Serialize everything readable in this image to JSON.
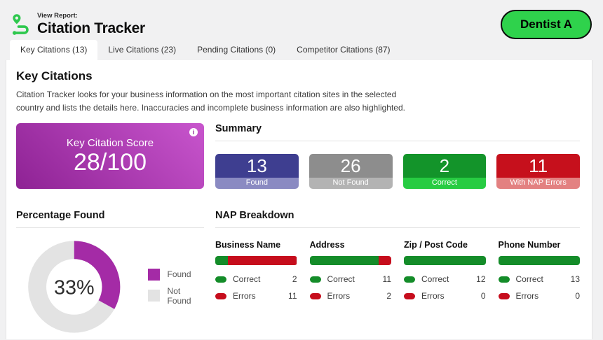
{
  "header": {
    "view_report_label": "View Report:",
    "title": "Citation Tracker",
    "business_button": "Dentist A",
    "brand_green": "#2fd24c"
  },
  "tabs": [
    {
      "label": "Key Citations (13)",
      "active": true
    },
    {
      "label": "Live Citations (23)",
      "active": false
    },
    {
      "label": "Pending Citations (0)",
      "active": false
    },
    {
      "label": "Competitor Citations (87)",
      "active": false
    }
  ],
  "main": {
    "heading": "Key Citations",
    "description": "Citation Tracker looks for your business information on the most important citation sites in the selected country and lists the details here. Inaccuracies and incomplete business information are also highlighted.",
    "score_card": {
      "label": "Key Citation Score",
      "value": "28/100",
      "info_icon_glyph": "i",
      "gradient_from": "#8e2294",
      "gradient_to": "#c855cd"
    },
    "summary": {
      "heading": "Summary",
      "cards": [
        {
          "value": "13",
          "label": "Found",
          "color": "#3e3e90",
          "footer_color": "#8a8ac2"
        },
        {
          "value": "26",
          "label": "Not Found",
          "color": "#8d8d8d",
          "footer_color": "#b3b3b3"
        },
        {
          "value": "2",
          "label": "Correct",
          "color": "#13942a",
          "footer_color": "#27cc42"
        },
        {
          "value": "11",
          "label": "With NAP Errors",
          "color": "#c6101c",
          "footer_color": "#e38181"
        }
      ]
    },
    "percentage_found": {
      "heading": "Percentage Found",
      "center_label": "33%",
      "legend": [
        {
          "label": "Found",
          "color": "#a42ba6"
        },
        {
          "label": "Not Found",
          "color": "#e3e3e3"
        }
      ]
    },
    "nap_breakdown": {
      "heading": "NAP Breakdown",
      "correct_label": "Correct",
      "errors_label": "Errors",
      "correct_color": "#148c29",
      "errors_color": "#c60d1c",
      "columns": [
        {
          "title": "Business Name",
          "correct": 2,
          "errors": 11
        },
        {
          "title": "Address",
          "correct": 11,
          "errors": 2
        },
        {
          "title": "Zip / Post Code",
          "correct": 12,
          "errors": 0
        },
        {
          "title": "Phone Number",
          "correct": 13,
          "errors": 0
        }
      ]
    }
  },
  "chart_data": [
    {
      "type": "pie",
      "title": "Percentage Found",
      "donut": true,
      "labels": [
        "Found",
        "Not Found"
      ],
      "values": [
        33,
        67
      ],
      "colors": [
        "#a42ba6",
        "#e3e3e3"
      ],
      "center_label": "33%",
      "legend_position": "right"
    },
    {
      "type": "bar",
      "title": "NAP Breakdown",
      "layout": "horizontal-stacked-percent",
      "categories": [
        "Business Name",
        "Address",
        "Zip / Post Code",
        "Phone Number"
      ],
      "series": [
        {
          "name": "Correct",
          "values": [
            2,
            11,
            12,
            13
          ],
          "color": "#148c29"
        },
        {
          "name": "Errors",
          "values": [
            11,
            2,
            0,
            0
          ],
          "color": "#c60d1c"
        }
      ]
    }
  ]
}
